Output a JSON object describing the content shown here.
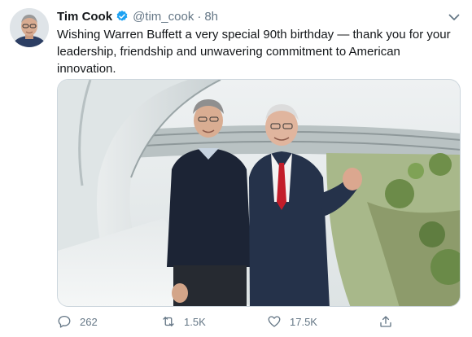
{
  "tweet": {
    "author_name": "Tim Cook",
    "handle": "@tim_cook",
    "separator": "·",
    "time": "8h",
    "text": "Wishing Warren Buffett a very special 90th birthday — thank you for your leadership, friendship and unwavering commitment to American innovation.",
    "verified": true
  },
  "actions": {
    "reply_count": "262",
    "retweet_count": "1.5K",
    "like_count": "17.5K"
  },
  "icons": {
    "verified": "verified-badge-icon",
    "caret": "chevron-down-icon",
    "reply": "speech-bubble-icon",
    "retweet": "retweet-arrows-icon",
    "like": "heart-icon",
    "share": "share-upload-icon"
  },
  "colors": {
    "verified_blue": "#1da1f2",
    "muted_gray": "#657786",
    "text_dark": "#14171a"
  }
}
